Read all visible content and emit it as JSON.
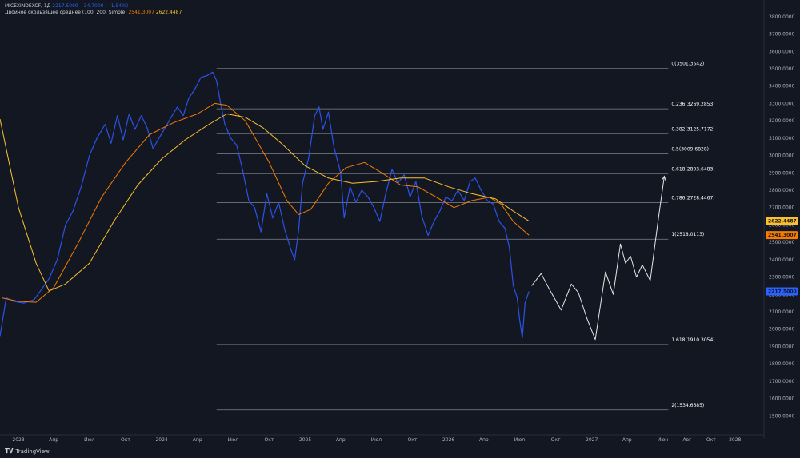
{
  "legend": {
    "symbol": "MICEXINDEXCF, 1Д",
    "ohlc": "2217.5000",
    "change": "−34.7000 (−1.54%)",
    "indicator": "Двойное скользящее среднее (100, 200, Simple)",
    "ma1_value": "2541.3007",
    "ma2_value": "2622.4487"
  },
  "brand": {
    "name": "TradingView"
  },
  "colors": {
    "background": "#131722",
    "price": "#2b52e8",
    "ma_fast": "#f57c00",
    "ma_slow": "#fbc02d",
    "projection": "#e6e6e6",
    "fib": "#9598a1",
    "axis_text": "#b2b5be"
  },
  "chart_data": {
    "type": "line",
    "title": "",
    "xlabel": "",
    "ylabel": "",
    "ylim": [
      1400,
      3850
    ],
    "x_domain": [
      "2022-11-15",
      "2028-03-15"
    ],
    "y_ticks": [
      "1500.0000",
      "1600.0000",
      "1700.0000",
      "1800.0000",
      "1900.0000",
      "2000.0000",
      "2100.0000",
      "2200.0000",
      "2300.0000",
      "2400.0000",
      "2500.0000",
      "2600.0000",
      "2700.0000",
      "2800.0000",
      "2900.0000",
      "3000.0000",
      "3100.0000",
      "3200.0000",
      "3300.0000",
      "3400.0000",
      "3500.0000",
      "3600.0000",
      "3700.0000",
      "3800.0000"
    ],
    "x_ticks": [
      {
        "date": "2023-01-01",
        "label": "2023"
      },
      {
        "date": "2023-04-01",
        "label": "Апр"
      },
      {
        "date": "2023-07-01",
        "label": "Июл"
      },
      {
        "date": "2023-10-01",
        "label": "Окт"
      },
      {
        "date": "2024-01-01",
        "label": "2024"
      },
      {
        "date": "2024-04-01",
        "label": "Апр"
      },
      {
        "date": "2024-07-01",
        "label": "Июл"
      },
      {
        "date": "2024-10-01",
        "label": "Окт"
      },
      {
        "date": "2025-01-01",
        "label": "2025"
      },
      {
        "date": "2025-04-01",
        "label": "Апр"
      },
      {
        "date": "2025-07-01",
        "label": "Июл"
      },
      {
        "date": "2025-10-01",
        "label": "Окт"
      },
      {
        "date": "2026-01-01",
        "label": "2026"
      },
      {
        "date": "2026-04-01",
        "label": "Апр"
      },
      {
        "date": "2026-07-01",
        "label": "Июл"
      },
      {
        "date": "2026-10-01",
        "label": "Окт"
      },
      {
        "date": "2027-01-01",
        "label": "2027"
      },
      {
        "date": "2027-04-01",
        "label": "Апр"
      },
      {
        "date": "2027-07-01",
        "label": "Июн"
      },
      {
        "date": "2027-09-01",
        "label": "Авг"
      },
      {
        "date": "2027-11-01",
        "label": "Окт"
      },
      {
        "date": "2028-01-01",
        "label": "2028"
      }
    ],
    "series": [
      {
        "key": "price",
        "points": [
          [
            "2022-11-15",
            1960
          ],
          [
            "2022-12-01",
            2180
          ],
          [
            "2022-12-20",
            2160
          ],
          [
            "2023-01-15",
            2150
          ],
          [
            "2023-02-10",
            2170
          ],
          [
            "2023-03-01",
            2230
          ],
          [
            "2023-03-20",
            2290
          ],
          [
            "2023-04-10",
            2400
          ],
          [
            "2023-05-01",
            2600
          ],
          [
            "2023-05-20",
            2680
          ],
          [
            "2023-06-10",
            2820
          ],
          [
            "2023-07-01",
            3000
          ],
          [
            "2023-07-20",
            3100
          ],
          [
            "2023-08-10",
            3180
          ],
          [
            "2023-08-25",
            3070
          ],
          [
            "2023-09-10",
            3230
          ],
          [
            "2023-09-25",
            3090
          ],
          [
            "2023-10-10",
            3240
          ],
          [
            "2023-10-25",
            3150
          ],
          [
            "2023-11-10",
            3230
          ],
          [
            "2023-11-25",
            3160
          ],
          [
            "2023-12-10",
            3040
          ],
          [
            "2023-12-25",
            3100
          ],
          [
            "2024-01-10",
            3160
          ],
          [
            "2024-01-25",
            3220
          ],
          [
            "2024-02-10",
            3280
          ],
          [
            "2024-02-25",
            3230
          ],
          [
            "2024-03-10",
            3330
          ],
          [
            "2024-03-25",
            3380
          ],
          [
            "2024-04-10",
            3450
          ],
          [
            "2024-04-25",
            3460
          ],
          [
            "2024-05-10",
            3480
          ],
          [
            "2024-05-20",
            3430
          ],
          [
            "2024-05-30",
            3300
          ],
          [
            "2024-06-10",
            3180
          ],
          [
            "2024-06-25",
            3100
          ],
          [
            "2024-07-10",
            3060
          ],
          [
            "2024-07-25",
            2920
          ],
          [
            "2024-08-10",
            2740
          ],
          [
            "2024-08-25",
            2700
          ],
          [
            "2024-09-10",
            2560
          ],
          [
            "2024-09-25",
            2780
          ],
          [
            "2024-10-10",
            2640
          ],
          [
            "2024-10-25",
            2730
          ],
          [
            "2024-11-10",
            2570
          ],
          [
            "2024-11-25",
            2460
          ],
          [
            "2024-12-05",
            2400
          ],
          [
            "2024-12-15",
            2570
          ],
          [
            "2024-12-25",
            2840
          ],
          [
            "2025-01-10",
            2990
          ],
          [
            "2025-01-25",
            3230
          ],
          [
            "2025-02-05",
            3280
          ],
          [
            "2025-02-15",
            3150
          ],
          [
            "2025-03-01",
            3250
          ],
          [
            "2025-03-15",
            3050
          ],
          [
            "2025-04-01",
            2900
          ],
          [
            "2025-04-10",
            2640
          ],
          [
            "2025-04-25",
            2820
          ],
          [
            "2025-05-10",
            2730
          ],
          [
            "2025-05-25",
            2800
          ],
          [
            "2025-06-10",
            2760
          ],
          [
            "2025-06-25",
            2700
          ],
          [
            "2025-07-10",
            2620
          ],
          [
            "2025-07-25",
            2780
          ],
          [
            "2025-08-10",
            2920
          ],
          [
            "2025-08-25",
            2840
          ],
          [
            "2025-09-10",
            2890
          ],
          [
            "2025-09-25",
            2760
          ],
          [
            "2025-10-10",
            2850
          ],
          [
            "2025-10-25",
            2650
          ],
          [
            "2025-11-10",
            2540
          ],
          [
            "2025-11-25",
            2620
          ],
          [
            "2025-12-10",
            2680
          ],
          [
            "2025-12-25",
            2760
          ],
          [
            "2026-01-10",
            2740
          ],
          [
            "2026-01-25",
            2800
          ],
          [
            "2026-02-10",
            2740
          ],
          [
            "2026-02-25",
            2850
          ],
          [
            "2026-03-10",
            2870
          ],
          [
            "2026-03-25",
            2800
          ],
          [
            "2026-04-10",
            2740
          ],
          [
            "2026-04-25",
            2720
          ],
          [
            "2026-05-10",
            2620
          ],
          [
            "2026-05-25",
            2580
          ],
          [
            "2026-06-05",
            2470
          ],
          [
            "2026-06-15",
            2250
          ],
          [
            "2026-06-25",
            2180
          ],
          [
            "2026-07-01",
            2060
          ],
          [
            "2026-07-08",
            1950
          ],
          [
            "2026-07-15",
            2150
          ],
          [
            "2026-07-25",
            2217.5
          ]
        ]
      },
      {
        "key": "ma_fast",
        "points": [
          [
            "2022-11-20",
            2180
          ],
          [
            "2023-01-01",
            2160
          ],
          [
            "2023-02-15",
            2155
          ],
          [
            "2023-04-01",
            2240
          ],
          [
            "2023-06-01",
            2490
          ],
          [
            "2023-08-01",
            2760
          ],
          [
            "2023-10-01",
            2960
          ],
          [
            "2023-12-01",
            3120
          ],
          [
            "2024-02-01",
            3190
          ],
          [
            "2024-04-01",
            3240
          ],
          [
            "2024-05-15",
            3300
          ],
          [
            "2024-06-15",
            3290
          ],
          [
            "2024-08-01",
            3200
          ],
          [
            "2024-10-01",
            2960
          ],
          [
            "2024-11-15",
            2740
          ],
          [
            "2024-12-15",
            2660
          ],
          [
            "2025-01-15",
            2690
          ],
          [
            "2025-03-01",
            2840
          ],
          [
            "2025-04-15",
            2930
          ],
          [
            "2025-06-01",
            2960
          ],
          [
            "2025-07-15",
            2900
          ],
          [
            "2025-09-01",
            2830
          ],
          [
            "2025-10-15",
            2820
          ],
          [
            "2025-12-01",
            2760
          ],
          [
            "2026-01-15",
            2700
          ],
          [
            "2026-03-01",
            2740
          ],
          [
            "2026-04-15",
            2760
          ],
          [
            "2026-05-15",
            2720
          ],
          [
            "2026-06-15",
            2620
          ],
          [
            "2026-07-25",
            2541.3007
          ]
        ]
      },
      {
        "key": "ma_slow",
        "points": [
          [
            "2022-11-15",
            3210
          ],
          [
            "2023-01-01",
            2700
          ],
          [
            "2023-02-15",
            2380
          ],
          [
            "2023-03-20",
            2220
          ],
          [
            "2023-05-01",
            2260
          ],
          [
            "2023-07-01",
            2380
          ],
          [
            "2023-09-01",
            2620
          ],
          [
            "2023-11-01",
            2830
          ],
          [
            "2024-01-01",
            2980
          ],
          [
            "2024-03-01",
            3090
          ],
          [
            "2024-05-01",
            3180
          ],
          [
            "2024-06-15",
            3240
          ],
          [
            "2024-08-01",
            3220
          ],
          [
            "2024-09-15",
            3160
          ],
          [
            "2024-11-01",
            3070
          ],
          [
            "2025-01-01",
            2940
          ],
          [
            "2025-03-01",
            2870
          ],
          [
            "2025-05-01",
            2840
          ],
          [
            "2025-07-01",
            2850
          ],
          [
            "2025-09-01",
            2870
          ],
          [
            "2025-11-01",
            2870
          ],
          [
            "2026-01-01",
            2820
          ],
          [
            "2026-03-01",
            2780
          ],
          [
            "2026-05-01",
            2750
          ],
          [
            "2026-06-15",
            2680
          ],
          [
            "2026-07-25",
            2622.4487
          ]
        ]
      },
      {
        "key": "projection",
        "points": [
          [
            "2026-08-01",
            2250
          ],
          [
            "2026-08-25",
            2320
          ],
          [
            "2026-09-15",
            2230
          ],
          [
            "2026-10-15",
            2110
          ],
          [
            "2026-11-10",
            2260
          ],
          [
            "2026-11-28",
            2210
          ],
          [
            "2026-12-20",
            2060
          ],
          [
            "2027-01-10",
            1940
          ],
          [
            "2027-02-05",
            2330
          ],
          [
            "2027-02-25",
            2200
          ],
          [
            "2027-03-15",
            2490
          ],
          [
            "2027-03-28",
            2380
          ],
          [
            "2027-04-10",
            2420
          ],
          [
            "2027-04-25",
            2300
          ],
          [
            "2027-05-10",
            2370
          ],
          [
            "2027-05-30",
            2280
          ],
          [
            "2027-06-20",
            2640
          ],
          [
            "2027-07-05",
            2880
          ]
        ]
      }
    ],
    "fib_levels": [
      {
        "value": 3501.3542,
        "label": "0(3501.3542)"
      },
      {
        "value": 3269.2853,
        "label": "0.236(3269.2853)"
      },
      {
        "value": 3125.7172,
        "label": "0.382(3125.7172)"
      },
      {
        "value": 3009.6828,
        "label": "0.5(3009.6828)"
      },
      {
        "value": 2893.6483,
        "label": "0.618(2893.6483)"
      },
      {
        "value": 2728.4467,
        "label": "0.786(2728.4467)"
      },
      {
        "value": 2518.0113,
        "label": "1(2518.0113)"
      },
      {
        "value": 1910.3054,
        "label": "1.618(1910.3054)"
      },
      {
        "value": 1534.6685,
        "label": "2(1534.6685)"
      }
    ],
    "fib_range": [
      "2024-05-20",
      "2027-07-15"
    ],
    "price_tags": [
      {
        "value": 2622.4487,
        "label": "2622.4487",
        "color": "#fbc02d"
      },
      {
        "value": 2541.3007,
        "label": "2541.3007",
        "color": "#f57c00"
      },
      {
        "value": 2217.5,
        "label": "2217.5000",
        "color": "#2962ff"
      }
    ]
  }
}
